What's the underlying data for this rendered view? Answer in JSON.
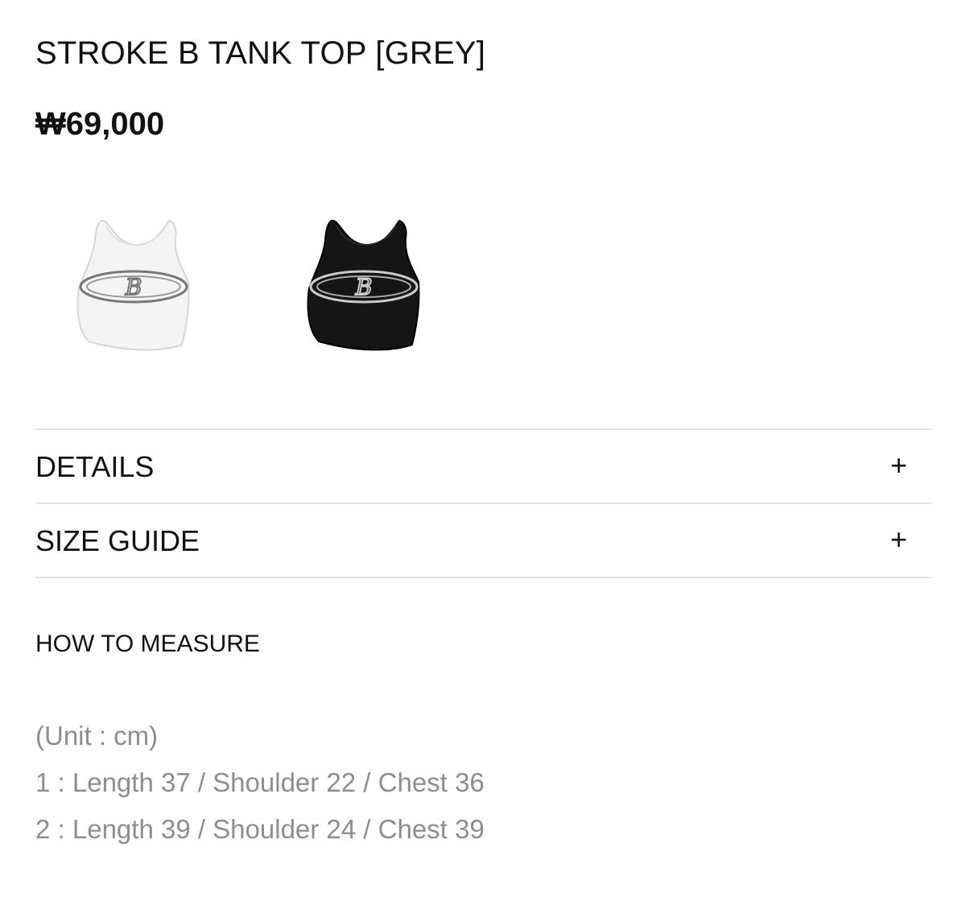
{
  "product": {
    "title": "STROKE B TANK TOP [GREY]",
    "price": "₩69,000"
  },
  "swatches": [
    {
      "name": "white",
      "color": "#f4f4f4",
      "logo_color": "#777777"
    },
    {
      "name": "black",
      "color": "#151515",
      "logo_color": "#cccccc"
    }
  ],
  "accordion": [
    {
      "label": "DETAILS",
      "icon": "plus-icon",
      "symbol": "+"
    },
    {
      "label": "SIZE GUIDE",
      "icon": "plus-icon",
      "symbol": "+"
    }
  ],
  "measure": {
    "heading": "HOW TO MEASURE",
    "unit": "(Unit : cm)",
    "sizes": [
      "1 : Length 37 / Shoulder 22 / Chest 36",
      "2 : Length 39 / Shoulder 24 / Chest 39"
    ]
  },
  "colors": {
    "text": "#111111",
    "muted_text": "#8e8e8e",
    "divider": "#e2e2e2"
  }
}
